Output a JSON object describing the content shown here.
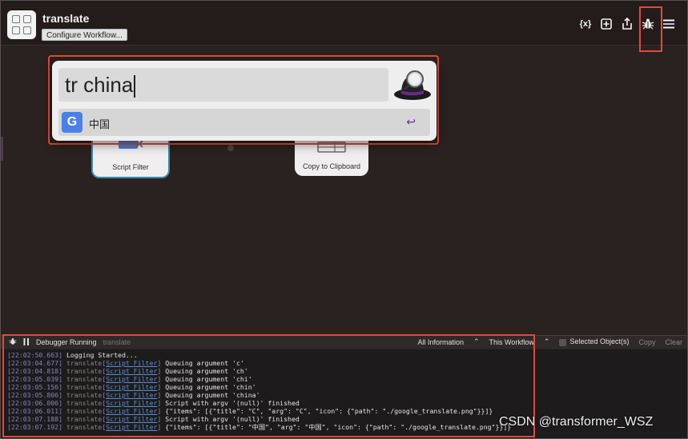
{
  "workflow": {
    "title": "translate",
    "configure_label": "Configure Workflow..."
  },
  "header_icons": [
    "variables-icon",
    "add-icon",
    "share-icon",
    "bug-icon",
    "menu-icon"
  ],
  "header_icon_glyphs": {
    "variables": "{x}",
    "add": "+"
  },
  "nodes": {
    "script_filter": "Script Filter",
    "clipboard": "Copy to Clipboard"
  },
  "alfred": {
    "query": "tr china",
    "result_title": "中国",
    "result_glyph": "↩"
  },
  "debugger": {
    "status": "Debugger Running",
    "workflow_name": "translate",
    "level": "All Information",
    "scope": "This Workflow",
    "selected_label": "Selected Object(s)",
    "copy_label": "Copy",
    "clear_label": "Clear",
    "log": [
      {
        "ts": "[22:02:50.663]",
        "src": "",
        "link": "",
        "msg": "Logging Started..."
      },
      {
        "ts": "[22:03:04.677]",
        "src": "translate[",
        "link": "Script Filter",
        "msg": "Queuing argument 'c'"
      },
      {
        "ts": "[22:03:04.818]",
        "src": "translate[",
        "link": "Script Filter",
        "msg": "Queuing argument 'ch'"
      },
      {
        "ts": "[22:03:05.039]",
        "src": "translate[",
        "link": "Script Filter",
        "msg": "Queuing argument 'chi'"
      },
      {
        "ts": "[22:03:05.156]",
        "src": "translate[",
        "link": "Script Filter",
        "msg": "Queuing argument 'chin'"
      },
      {
        "ts": "[22:03:05.806]",
        "src": "translate[",
        "link": "Script Filter",
        "msg": "Queuing argument 'china'"
      },
      {
        "ts": "[22:03:06.006]",
        "src": "translate[",
        "link": "Script Filter",
        "msg": "Script with argv '(null)' finished"
      },
      {
        "ts": "[22:03:06.011]",
        "src": "translate[",
        "link": "Script Filter",
        "msg": "{\"items\": [{\"title\": \"C\", \"arg\": \"C\", \"icon\": {\"path\": \"./google_translate.png\"}}]}"
      },
      {
        "ts": "[22:03:07.188]",
        "src": "translate[",
        "link": "Script Filter",
        "msg": "Script with argv '(null)' finished"
      },
      {
        "ts": "[22:03:07.192]",
        "src": "translate[",
        "link": "Script Filter",
        "msg": "{\"items\": [{\"title\": \"中国\", \"arg\": \"中国\", \"icon\": {\"path\": \"./google_translate.png\"}}]}"
      }
    ]
  },
  "watermark": "CSDN @transformer_WSZ",
  "colors": {
    "highlight": "#e04a3a",
    "background": "#2a2220",
    "link": "#5b8fd6",
    "timestamp": "#7d86c4"
  }
}
